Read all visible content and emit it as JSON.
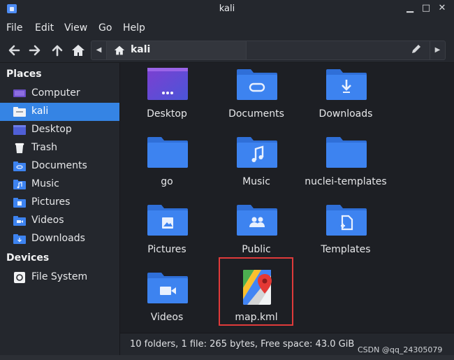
{
  "window": {
    "title": "kali"
  },
  "menu": [
    "File",
    "Edit",
    "View",
    "Go",
    "Help"
  ],
  "toolbar": {
    "back_icon": "back-arrow-icon",
    "forward_icon": "forward-arrow-icon",
    "up_icon": "up-arrow-icon",
    "home_icon": "home-icon"
  },
  "pathbar": {
    "current": "kali"
  },
  "sidebar": {
    "places_title": "Places",
    "places": [
      {
        "label": "Computer",
        "icon": "computer-icon"
      },
      {
        "label": "kali",
        "icon": "home-folder-icon",
        "active": true
      },
      {
        "label": "Desktop",
        "icon": "desktop-icon"
      },
      {
        "label": "Trash",
        "icon": "trash-icon"
      },
      {
        "label": "Documents",
        "icon": "documents-folder-icon"
      },
      {
        "label": "Music",
        "icon": "music-folder-icon"
      },
      {
        "label": "Pictures",
        "icon": "pictures-folder-icon"
      },
      {
        "label": "Videos",
        "icon": "videos-folder-icon"
      },
      {
        "label": "Downloads",
        "icon": "downloads-folder-icon"
      }
    ],
    "devices_title": "Devices",
    "devices": [
      {
        "label": "File System",
        "icon": "drive-icon"
      }
    ]
  },
  "files": [
    {
      "name": "Desktop",
      "icon": "desktop-folder-icon"
    },
    {
      "name": "Documents",
      "icon": "documents-folder-icon"
    },
    {
      "name": "Downloads",
      "icon": "downloads-folder-icon"
    },
    {
      "name": "go",
      "icon": "folder-icon"
    },
    {
      "name": "Music",
      "icon": "music-folder-icon"
    },
    {
      "name": "nuclei-templates",
      "icon": "folder-icon"
    },
    {
      "name": "Pictures",
      "icon": "pictures-folder-icon"
    },
    {
      "name": "Public",
      "icon": "public-folder-icon"
    },
    {
      "name": "Templates",
      "icon": "templates-folder-icon"
    },
    {
      "name": "Videos",
      "icon": "videos-folder-icon"
    },
    {
      "name": "map.kml",
      "icon": "map-file-icon"
    }
  ],
  "status": {
    "text": "10 folders, 1 file: 265 bytes, Free space: 43.0 GiB"
  },
  "watermark": "CSDN @qq_24305079",
  "colors": {
    "accent": "#3584e4",
    "folder": "#3d83f0",
    "highlight_border": "#e03a3a"
  }
}
